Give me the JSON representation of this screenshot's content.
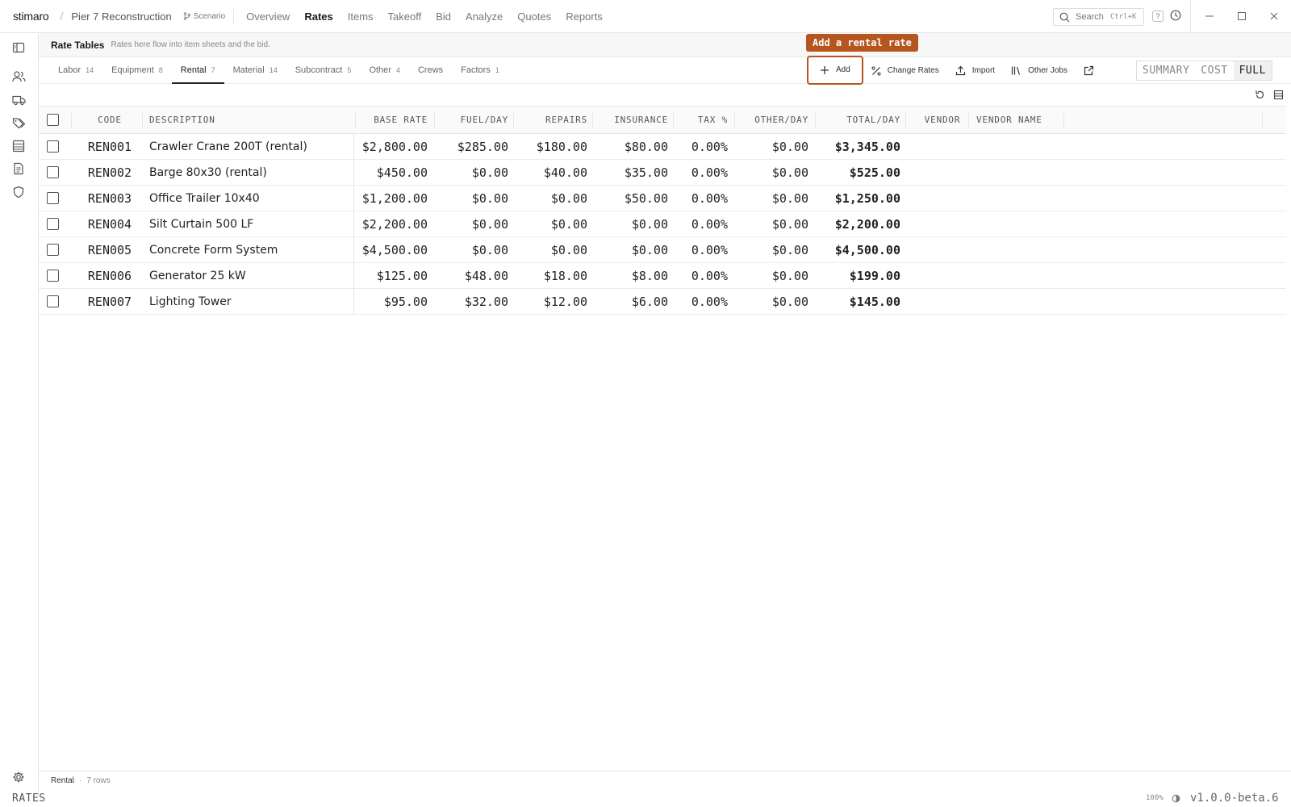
{
  "app": {
    "brand": "stimaro",
    "project": "Pier 7 Reconstruction",
    "scenario": "Scenario"
  },
  "nav": [
    "Overview",
    "Rates",
    "Items",
    "Takeoff",
    "Bid",
    "Analyze",
    "Quotes",
    "Reports"
  ],
  "nav_active": "Rates",
  "search": {
    "label": "Search",
    "shortcut": "Ctrl+K"
  },
  "help_label": "?",
  "page": {
    "title": "Rate Tables",
    "description": "Rates here flow into item sheets and the bid."
  },
  "tabs": [
    {
      "label": "Labor",
      "count": "14"
    },
    {
      "label": "Equipment",
      "count": "8"
    },
    {
      "label": "Rental",
      "count": "7",
      "active": true
    },
    {
      "label": "Material",
      "count": "14"
    },
    {
      "label": "Subcontract",
      "count": "5"
    },
    {
      "label": "Other",
      "count": "4"
    },
    {
      "label": "Crews",
      "count": ""
    },
    {
      "label": "Factors",
      "count": "1"
    }
  ],
  "actions": {
    "add": "Add",
    "change_rates": "Change Rates",
    "import": "Import",
    "other_jobs": "Other Jobs"
  },
  "tooltip": "Add a rental rate",
  "view_modes": [
    "SUMMARY",
    "COST",
    "FULL"
  ],
  "view_mode_active": "FULL",
  "table": {
    "headers": [
      "CODE",
      "DESCRIPTION",
      "BASE RATE",
      "FUEL/DAY",
      "REPAIRS",
      "INSURANCE",
      "TAX %",
      "OTHER/DAY",
      "TOTAL/DAY",
      "VENDOR",
      "VENDOR NAME"
    ],
    "rows": [
      [
        "REN001",
        "Crawler Crane 200T (rental)",
        "$2,800.00",
        "$285.00",
        "$180.00",
        "$80.00",
        "0.00%",
        "$0.00",
        "$3,345.00",
        "",
        ""
      ],
      [
        "REN002",
        "Barge 80x30 (rental)",
        "$450.00",
        "$0.00",
        "$40.00",
        "$35.00",
        "0.00%",
        "$0.00",
        "$525.00",
        "",
        ""
      ],
      [
        "REN003",
        "Office Trailer 10x40",
        "$1,200.00",
        "$0.00",
        "$0.00",
        "$50.00",
        "0.00%",
        "$0.00",
        "$1,250.00",
        "",
        ""
      ],
      [
        "REN004",
        "Silt Curtain 500 LF",
        "$2,200.00",
        "$0.00",
        "$0.00",
        "$0.00",
        "0.00%",
        "$0.00",
        "$2,200.00",
        "",
        ""
      ],
      [
        "REN005",
        "Concrete Form System",
        "$4,500.00",
        "$0.00",
        "$0.00",
        "$0.00",
        "0.00%",
        "$0.00",
        "$4,500.00",
        "",
        ""
      ],
      [
        "REN006",
        "Generator 25 kW",
        "$125.00",
        "$48.00",
        "$18.00",
        "$8.00",
        "0.00%",
        "$0.00",
        "$199.00",
        "",
        ""
      ],
      [
        "REN007",
        "Lighting Tower",
        "$95.00",
        "$32.00",
        "$12.00",
        "$6.00",
        "0.00%",
        "$0.00",
        "$145.00",
        "",
        ""
      ]
    ]
  },
  "footer": {
    "tab": "Rental",
    "rows": "7 rows"
  },
  "status": {
    "section": "RATES",
    "zoom": "100%",
    "version": "v1.0.0-beta.6"
  },
  "colors": {
    "accent": "#b5561f"
  }
}
